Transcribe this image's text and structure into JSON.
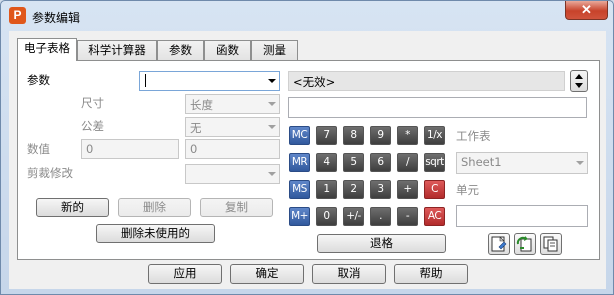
{
  "window": {
    "title": "参数编辑",
    "app_icon": "P",
    "close_glyph": "✕"
  },
  "tabs": [
    "电子表格",
    "科学计算器",
    "参数",
    "函数",
    "测量"
  ],
  "params": {
    "label": "参数",
    "value": "",
    "size_label": "尺寸",
    "size_value": "长度",
    "tolerance_label": "公差",
    "tolerance_value": "无",
    "numeric_label": "数值",
    "numeric_value_left": "0",
    "numeric_value_right": "0",
    "trim_label": "剪裁修改",
    "trim_value": ""
  },
  "buttons": {
    "new": "新的",
    "delete": "删除",
    "copy": "复制",
    "delete_unused": "删除未使用的",
    "backspace": "退格",
    "apply": "应用",
    "ok": "确定",
    "cancel": "取消",
    "help": "帮助"
  },
  "calculator": {
    "display": "<无效>",
    "input": "",
    "keys": [
      [
        "MC",
        "7",
        "8",
        "9",
        "*",
        "1/x"
      ],
      [
        "MR",
        "4",
        "5",
        "6",
        "/",
        "sqrt"
      ],
      [
        "MS",
        "1",
        "2",
        "3",
        "+",
        "C"
      ],
      [
        "M+",
        "0",
        "+/-",
        ".",
        "-",
        "AC"
      ]
    ]
  },
  "worksheet": {
    "label": "工作表",
    "value": "Sheet1",
    "cell_label": "单元",
    "cell_value": ""
  },
  "icons": [
    "spreadsheet-insert-icon",
    "refresh-icon",
    "copy-sheet-icon"
  ],
  "colors": {
    "memory_key": "#4a70b4",
    "number_key": "#555555",
    "clear_key": "#c43b3b"
  }
}
